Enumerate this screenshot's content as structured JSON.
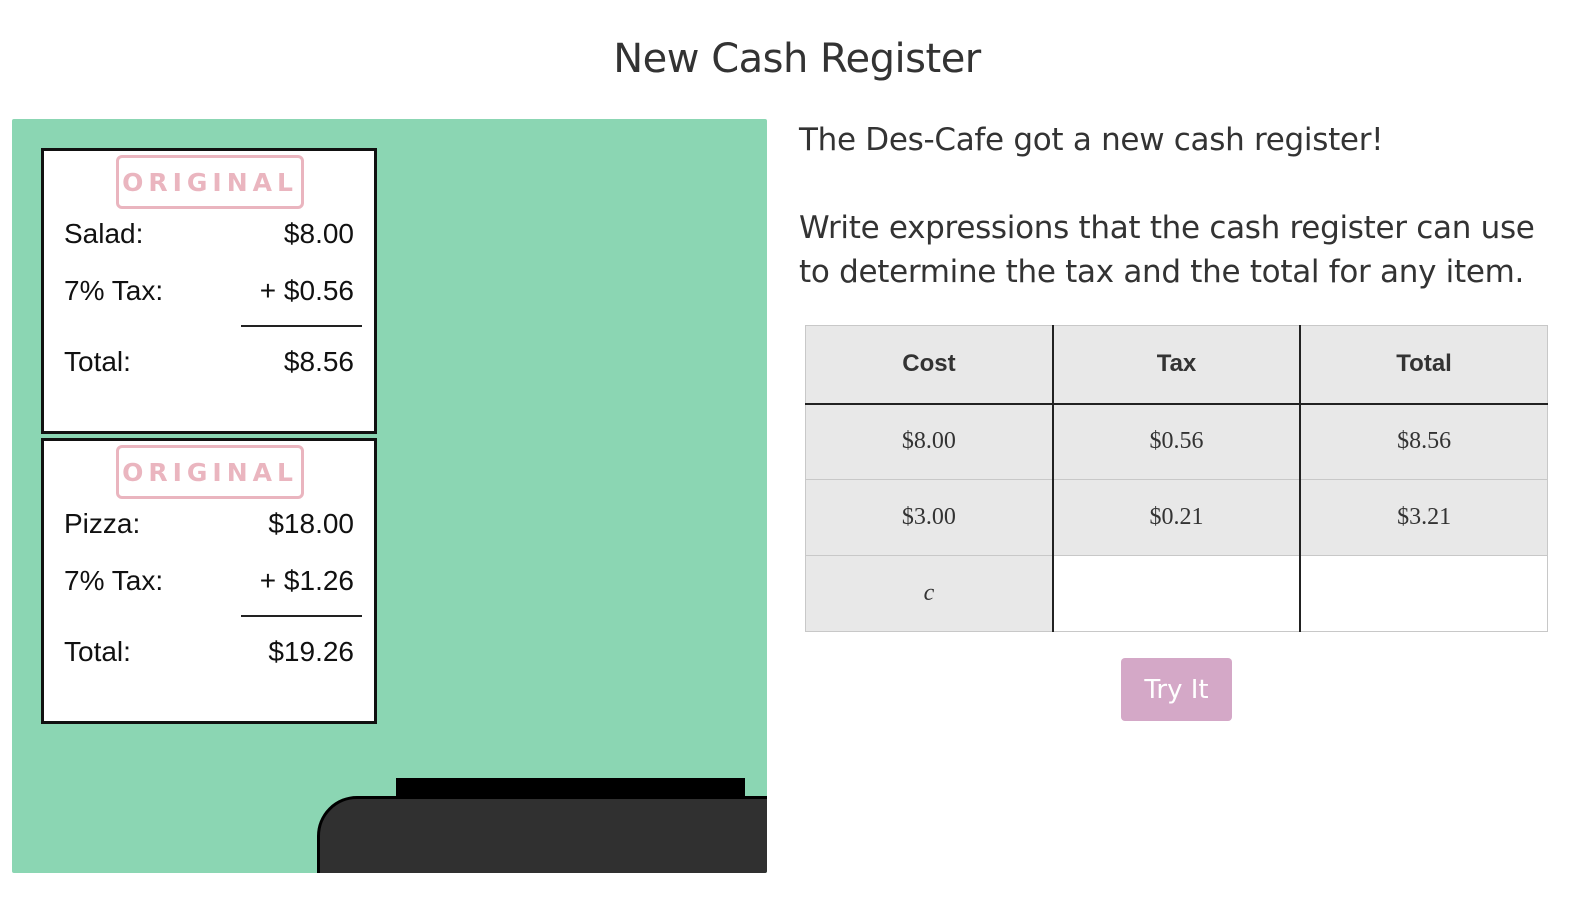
{
  "page": {
    "title": "New Cash Register"
  },
  "receipts": [
    {
      "stamp": "ORIGINAL",
      "item_label": "Salad:",
      "item_price": "$8.00",
      "tax_label": "7% Tax:",
      "tax_value": "+ $0.56",
      "total_label": "Total:",
      "total_value": "$8.56"
    },
    {
      "stamp": "ORIGINAL",
      "item_label": "Pizza:",
      "item_price": "$18.00",
      "tax_label": "7% Tax:",
      "tax_value": "+ $1.26",
      "total_label": "Total:",
      "total_value": "$19.26"
    }
  ],
  "prompt": {
    "line1": "The Des-Cafe got a new cash register!",
    "line2": "Write expressions that the cash register can use to determine the tax and the total for any item."
  },
  "table": {
    "headers": [
      "Cost",
      "Tax",
      "Total"
    ],
    "rows": [
      [
        "$8.00",
        "$0.56",
        "$8.56"
      ],
      [
        "$3.00",
        "$0.21",
        "$3.21"
      ]
    ],
    "input_row": {
      "cost": "c",
      "tax": "",
      "total": ""
    }
  },
  "button": {
    "label": "Try It"
  },
  "colors": {
    "illustration_bg": "#8bd6b3",
    "stamp": "#eab5bf",
    "button_bg": "#d4a8c7",
    "table_bg": "#e8e8e8"
  }
}
